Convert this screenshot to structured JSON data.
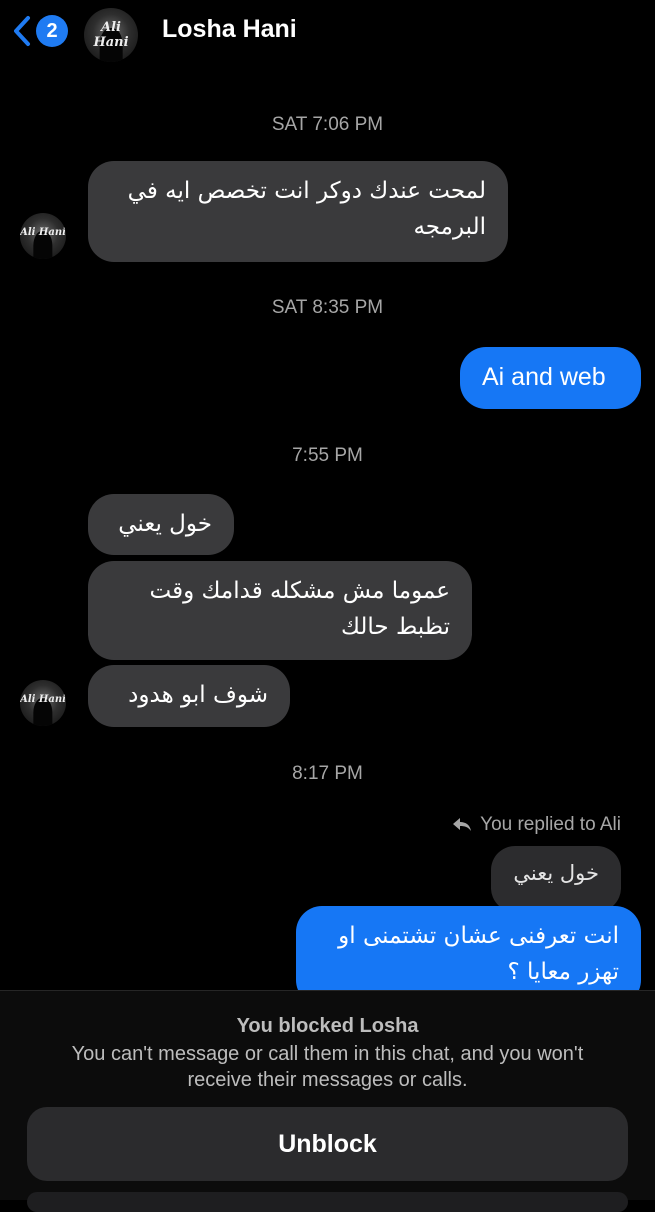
{
  "header": {
    "back_badge": "2",
    "contact_name": "Losha Hani",
    "avatar_text": "Ali Hani"
  },
  "conversation": {
    "timestamps": [
      "SAT 7:06 PM",
      "SAT 8:35 PM",
      "7:55 PM",
      "8:17 PM"
    ],
    "messages": [
      {
        "side": "incoming",
        "text": "لمحت عندك دوكر انت تخصص ايه في البرمجه"
      },
      {
        "side": "outgoing",
        "text": "Ai and web"
      },
      {
        "side": "incoming",
        "text": "خول يعني"
      },
      {
        "side": "incoming",
        "text": "عموما مش مشكله قدامك وقت تظبط حالك"
      },
      {
        "side": "incoming",
        "text": "شوف ابو هدود"
      },
      {
        "side": "outgoing",
        "text": "انت تعرفنى عشان تشتمنى او تهزر معايا ؟"
      }
    ],
    "reply_context": {
      "label": "You replied to Ali",
      "quoted_text": "خول يعني"
    }
  },
  "blocked_panel": {
    "title": "You blocked Losha",
    "description": "You can't message or call them in this chat, and you won't receive their messages or calls.",
    "unblock_label": "Unblock"
  },
  "colors": {
    "outgoing_bubble": "#1677f5",
    "incoming_bubble": "#3a3a3c",
    "badge": "#1f7bf2",
    "background": "#000000"
  }
}
